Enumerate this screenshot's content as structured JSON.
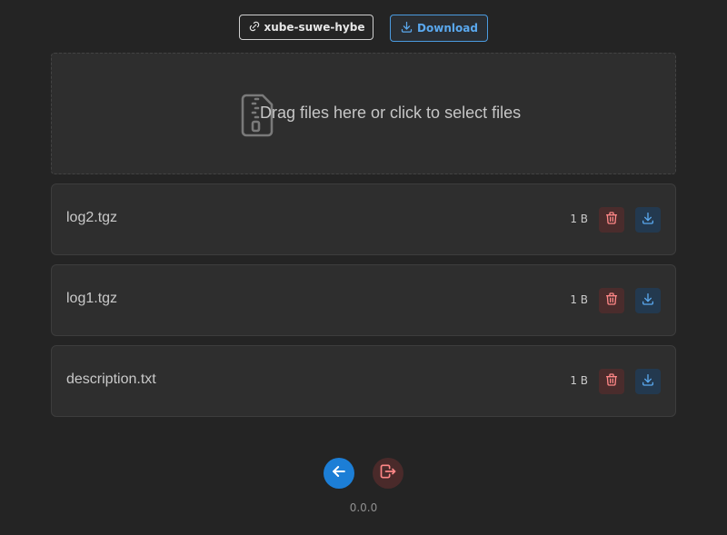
{
  "header": {
    "room_label": "xube-suwe-hybe",
    "room_icon": "link-icon",
    "download_label": "Download",
    "download_icon": "download-icon"
  },
  "dropzone": {
    "text": "Drag files here or click to select files",
    "icon": "file-zip-icon"
  },
  "files": [
    {
      "name": "log2.tgz",
      "size": "1 B"
    },
    {
      "name": "log1.tgz",
      "size": "1 B"
    },
    {
      "name": "description.txt",
      "size": "1 B"
    }
  ],
  "footer": {
    "back_icon": "arrow-left-icon",
    "leave_icon": "logout-icon",
    "version": "0.0.0"
  },
  "colors": {
    "background": "#242424",
    "accent_blue": "#1c7ed6",
    "danger_red": "#ff8787"
  }
}
